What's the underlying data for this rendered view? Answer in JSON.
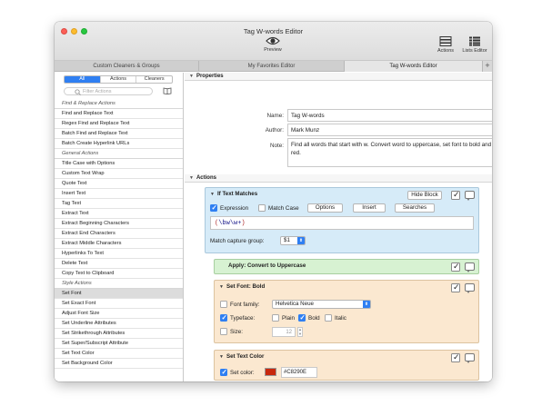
{
  "window": {
    "title": "Tag W-words Editor",
    "toolbar": {
      "preview": "Preview",
      "actions": "Actions",
      "lists_editor": "Lists Editor"
    }
  },
  "tabs": [
    {
      "label": "Custom Cleaners & Groups"
    },
    {
      "label": "My Favorites Editor"
    },
    {
      "label": "Tag W-words Editor"
    }
  ],
  "tab_add": "+",
  "sidebar": {
    "segments": [
      "All",
      "Actions",
      "Cleaners"
    ],
    "filter_placeholder": "Filter Actions",
    "items": [
      {
        "label": "Find & Replace Actions",
        "type": "category"
      },
      {
        "label": "Find and Replace Text"
      },
      {
        "label": "Regex Find and Replace Text"
      },
      {
        "label": "Batch Find and Replace Text"
      },
      {
        "label": "Batch Create Hyperlink URLs"
      },
      {
        "label": "General Actions",
        "type": "category"
      },
      {
        "label": "Title Case with Options"
      },
      {
        "label": "Custom Text Wrap"
      },
      {
        "label": "Quote Text"
      },
      {
        "label": "Insert Text"
      },
      {
        "label": "Tag Text"
      },
      {
        "label": "Extract Text"
      },
      {
        "label": "Extract Beginning Characters"
      },
      {
        "label": "Extract End Characters"
      },
      {
        "label": "Extract Middle Characters"
      },
      {
        "label": "Hyperlinks To Text"
      },
      {
        "label": "Delete Text"
      },
      {
        "label": "Copy Text to Clipboard"
      },
      {
        "label": "Style Actions",
        "type": "category"
      },
      {
        "label": "Set Font",
        "selected": true
      },
      {
        "label": "Set Exact Font"
      },
      {
        "label": "Adjust Font Size"
      },
      {
        "label": "Set Underline Attributes"
      },
      {
        "label": "Set Strikethrough Attributes"
      },
      {
        "label": "Set Super/Subscript Attribute"
      },
      {
        "label": "Set Text Color"
      },
      {
        "label": "Set Background Color"
      }
    ]
  },
  "properties": {
    "header": "Properties",
    "name_label": "Name:",
    "name": "Tag W-words",
    "author_label": "Author:",
    "author": "Mark Munz",
    "note_label": "Note:",
    "note": "Find all words that start with w. Convert word to uppercase, set font to bold and text color to red."
  },
  "actions": {
    "header": "Actions",
    "if_text_matches": {
      "title": "If Text Matches",
      "hide_block": "Hide Block",
      "expression_label": "Expression",
      "match_case_label": "Match Case",
      "options_button": "Options",
      "insert_button": "Insert",
      "searches_button": "Searches",
      "expression": "(\\bw\\w+)",
      "capture_group_label": "Match capture group:",
      "capture_group_value": "$1"
    },
    "convert": {
      "title": "Apply: Convert to Uppercase"
    },
    "set_font": {
      "title": "Set Font: Bold",
      "font_family_label": "Font family:",
      "font_family_value": "Helvetica Neue",
      "typeface_label": "Typeface:",
      "plain_label": "Plain",
      "bold_label": "Bold",
      "italic_label": "Italic",
      "size_label": "Size:",
      "size_value": "12"
    },
    "set_text_color": {
      "title": "Set Text Color",
      "set_color_label": "Set color:",
      "color_hex": "#C8290E"
    }
  },
  "colors": {
    "accent": "#2f7ff2",
    "if_block_bg": "#d6ebf8",
    "convert_block_bg": "#d7f2d2",
    "font_block_bg": "#fbe8d0",
    "color_block_bg": "#fbe8d0",
    "swatch": "#C8290E"
  }
}
